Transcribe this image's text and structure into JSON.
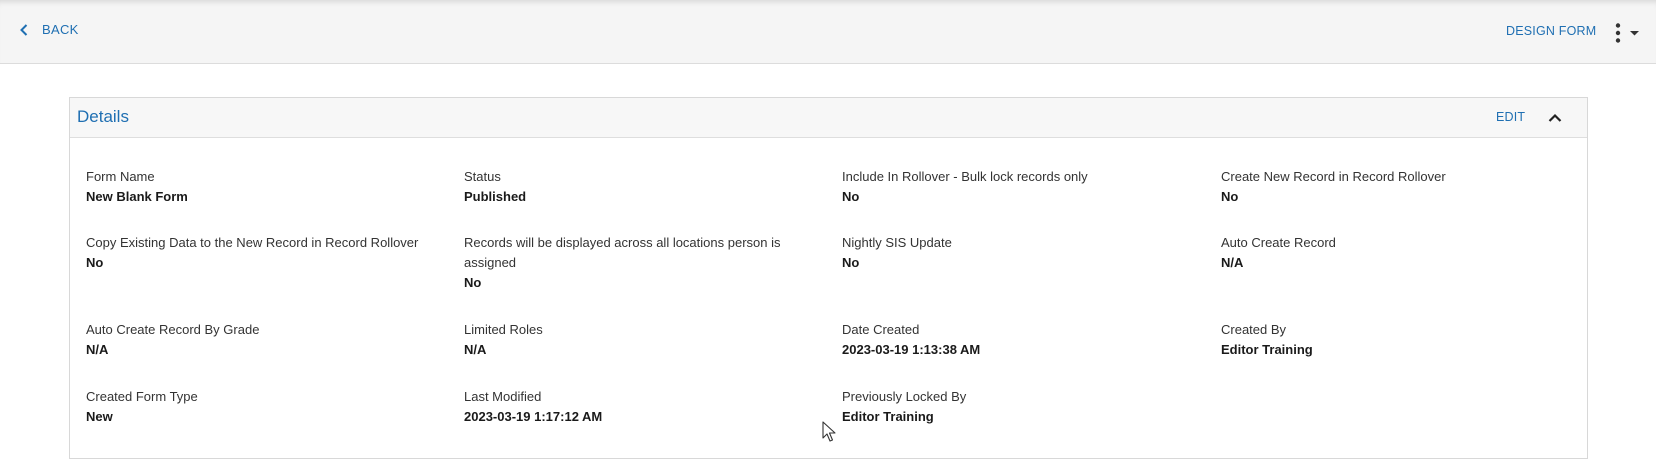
{
  "toolbar": {
    "back_label": "BACK",
    "design_form_label": "DESIGN FORM",
    "more_icon": "kebab-menu-icon"
  },
  "panel": {
    "title": "Details",
    "edit_label": "EDIT",
    "collapse_icon": "chevron-up-icon"
  },
  "fields": [
    {
      "label": "Form Name",
      "value": "New Blank Form"
    },
    {
      "label": "Status",
      "value": "Published"
    },
    {
      "label": "Include In Rollover - Bulk lock records only",
      "value": "No"
    },
    {
      "label": "Create New Record in Record Rollover",
      "value": "No"
    },
    {
      "label": "Copy Existing Data to the New Record in Record Rollover",
      "value": "No"
    },
    {
      "label": "Records will be displayed across all locations person is assigned",
      "value": "No"
    },
    {
      "label": "Nightly SIS Update",
      "value": "No"
    },
    {
      "label": "Auto Create Record",
      "value": "N/A"
    },
    {
      "label": "Auto Create Record By Grade",
      "value": "N/A"
    },
    {
      "label": "Limited Roles",
      "value": "N/A"
    },
    {
      "label": "Date Created",
      "value": "2023-03-19 1:13:38 AM"
    },
    {
      "label": "Created By",
      "value": "Editor Training"
    },
    {
      "label": "Created Form Type",
      "value": "New"
    },
    {
      "label": "Last Modified",
      "value": "2023-03-19 1:17:12 AM"
    },
    {
      "label": "Previously Locked By",
      "value": "Editor Training"
    }
  ]
}
